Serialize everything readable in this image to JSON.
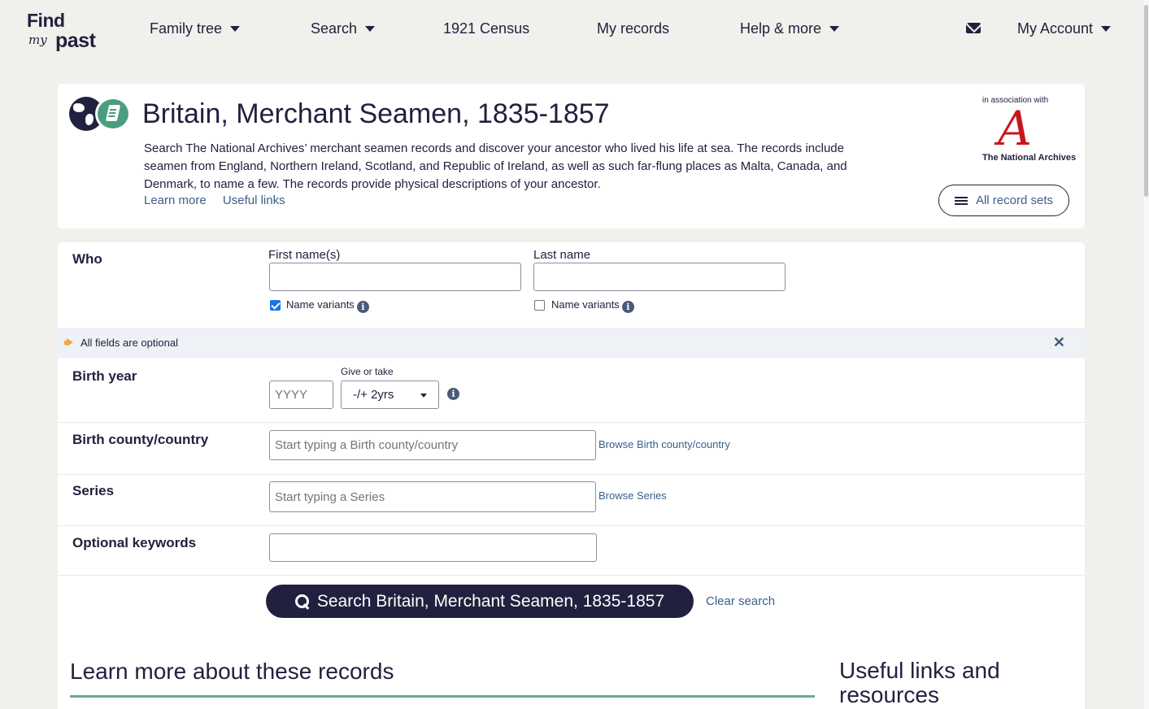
{
  "header": {
    "logo": {
      "find": "Find",
      "my": "my",
      "past": "past"
    },
    "nav": {
      "family_tree": "Family tree",
      "search": "Search",
      "census": "1921 Census",
      "my_records": "My records",
      "help_more": "Help & more",
      "my_account": "My Account"
    }
  },
  "title_card": {
    "title": "Britain, Merchant Seamen, 1835-1857",
    "description": "Search The National Archives’ merchant seamen records and discover your ancestor who lived his life at sea. The records include seamen from England, Northern Ireland, Scotland, and Republic of Ireland, as well as such far-flung places as Malta, Canada, and Denmark, to name a few. The records provide physical descriptions of your ancestor.",
    "learn_more": "Learn more",
    "useful_links": "Useful links",
    "association_text": "in association with",
    "partner_logo_letter": "A",
    "partner_name": "The National Archives",
    "all_record_sets": "All record sets"
  },
  "form": {
    "who_label": "Who",
    "first_name_label": "First name(s)",
    "first_name_value": "",
    "last_name_label": "Last name",
    "last_name_value": "",
    "first_name_variants_label": "Name variants",
    "first_name_variants_checked": true,
    "last_name_variants_label": "Name variants",
    "last_name_variants_checked": false,
    "notice": "All fields are optional",
    "birth_year_label": "Birth year",
    "birth_year_placeholder": "YYYY",
    "give_or_take_label": "Give or take",
    "give_or_take_value": "-/+ 2yrs",
    "birth_county_label": "Birth county/country",
    "birth_county_placeholder": "Start typing a Birth county/country",
    "browse_birth_county": "Browse Birth county/country",
    "series_label": "Series",
    "series_placeholder": "Start typing a Series",
    "browse_series": "Browse Series",
    "keywords_label": "Optional keywords",
    "keywords_value": "",
    "search_button": "Search Britain, Merchant Seamen, 1835-1857",
    "clear_search": "Clear search"
  },
  "below": {
    "learn_heading": "Learn more about these records",
    "useful_heading": "Useful links and resources"
  },
  "colors": {
    "navy": "#21213f",
    "link": "#3a5f8a",
    "accent_green": "#4b9c80",
    "tna_red": "#c8151b",
    "notice_bg": "#eef1f6",
    "page_bg": "#f2f0ec"
  }
}
